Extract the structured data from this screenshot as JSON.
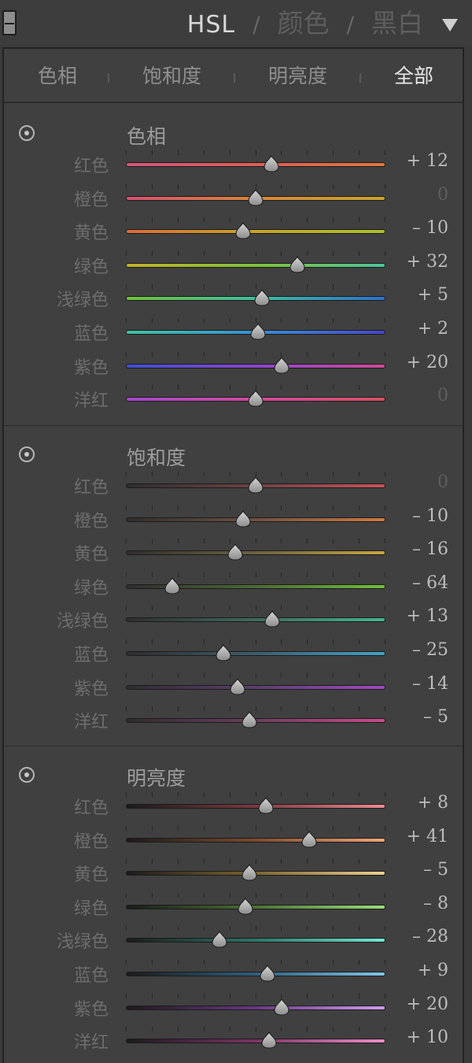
{
  "header": {
    "tabs": [
      {
        "label": "HSL",
        "active": true
      },
      {
        "label": "颜色",
        "active": false
      },
      {
        "label": "黑白",
        "active": false
      }
    ],
    "separator": "/",
    "collapse_icon": "triangle-down-icon"
  },
  "subtabs": [
    {
      "label": "色相",
      "active": false
    },
    {
      "label": "饱和度",
      "active": false
    },
    {
      "label": "明亮度",
      "active": false
    },
    {
      "label": "全部",
      "active": true
    }
  ],
  "slider_range": [
    -100,
    100
  ],
  "sections": [
    {
      "key": "hue",
      "title": "色相",
      "target_icon": "target-adjustment-icon",
      "rows": [
        {
          "label": "红色",
          "value": "+ 12",
          "num": 12,
          "colors": [
            "#d5567d",
            "#dd5e55",
            "#e2763e"
          ]
        },
        {
          "label": "橙色",
          "value": "0",
          "num": 0,
          "colors": [
            "#d95070",
            "#d8863a",
            "#c9a52c"
          ]
        },
        {
          "label": "黄色",
          "value": "– 10",
          "num": -10,
          "colors": [
            "#db6a3a",
            "#c7a42a",
            "#a8c02d"
          ]
        },
        {
          "label": "绿色",
          "value": "+ 32",
          "num": 32,
          "colors": [
            "#c2b12a",
            "#7fc13a",
            "#4cc59d"
          ]
        },
        {
          "label": "浅绿色",
          "value": "+ 5",
          "num": 5,
          "colors": [
            "#6fc23a",
            "#3fbfa0",
            "#2d6fcf"
          ]
        },
        {
          "label": "蓝色",
          "value": "+ 2",
          "num": 2,
          "colors": [
            "#3fc3a2",
            "#3a8fd3",
            "#4748c9"
          ]
        },
        {
          "label": "紫色",
          "value": "+ 20",
          "num": 20,
          "colors": [
            "#3f4fd0",
            "#8a46cc",
            "#cf4a98"
          ]
        },
        {
          "label": "洋红",
          "value": "0",
          "num": 0,
          "colors": [
            "#a448cf",
            "#d4489b",
            "#d94f62"
          ]
        }
      ]
    },
    {
      "key": "saturation",
      "title": "饱和度",
      "target_icon": "target-adjustment-icon",
      "rows": [
        {
          "label": "红色",
          "value": "0",
          "num": 0,
          "colors": [
            "#2e2e2e",
            "#6e4345",
            "#c9525c"
          ]
        },
        {
          "label": "橙色",
          "value": "– 10",
          "num": -10,
          "colors": [
            "#2e2e2e",
            "#6f5140",
            "#cc7a42"
          ]
        },
        {
          "label": "黄色",
          "value": "– 16",
          "num": -16,
          "colors": [
            "#2e2e2e",
            "#6b6240",
            "#c8a540"
          ]
        },
        {
          "label": "绿色",
          "value": "– 64",
          "num": -64,
          "colors": [
            "#2e2e2e",
            "#4c6a34",
            "#6fc03a"
          ]
        },
        {
          "label": "浅绿色",
          "value": "+ 13",
          "num": 13,
          "colors": [
            "#2e2e2e",
            "#3f6a5e",
            "#45b493"
          ]
        },
        {
          "label": "蓝色",
          "value": "– 25",
          "num": -25,
          "colors": [
            "#2e2e2e",
            "#3f5d6d",
            "#43a3c8"
          ]
        },
        {
          "label": "紫色",
          "value": "– 14",
          "num": -14,
          "colors": [
            "#2e2e2e",
            "#5a3f6e",
            "#a348c6"
          ]
        },
        {
          "label": "洋红",
          "value": "– 5",
          "num": -5,
          "colors": [
            "#2e2e2e",
            "#6a3f58",
            "#cb4a8e"
          ]
        }
      ]
    },
    {
      "key": "luminance",
      "title": "明亮度",
      "target_icon": "target-adjustment-icon",
      "rows": [
        {
          "label": "红色",
          "value": "+ 8",
          "num": 8,
          "colors": [
            "#1b1b1b",
            "#7a3940",
            "#ee8a92"
          ]
        },
        {
          "label": "橙色",
          "value": "+ 41",
          "num": 41,
          "colors": [
            "#1b1b1b",
            "#7d4a2c",
            "#f0a67a"
          ]
        },
        {
          "label": "黄色",
          "value": "– 5",
          "num": -5,
          "colors": [
            "#1b1b1b",
            "#7a6530",
            "#eed091"
          ]
        },
        {
          "label": "绿色",
          "value": "– 8",
          "num": -8,
          "colors": [
            "#1b1b1b",
            "#4b7233",
            "#97e07a"
          ]
        },
        {
          "label": "浅绿色",
          "value": "– 28",
          "num": -28,
          "colors": [
            "#1b1b1b",
            "#2f7468",
            "#73e6cf"
          ]
        },
        {
          "label": "蓝色",
          "value": "+ 9",
          "num": 9,
          "colors": [
            "#1b1b1b",
            "#2e5f7c",
            "#7fc5ea"
          ]
        },
        {
          "label": "紫色",
          "value": "+ 20",
          "num": 20,
          "colors": [
            "#1b1b1b",
            "#6a3684",
            "#d39bf0"
          ]
        },
        {
          "label": "洋红",
          "value": "+ 10",
          "num": 10,
          "colors": [
            "#1b1b1b",
            "#7c3462",
            "#ef8fc3"
          ]
        }
      ]
    }
  ]
}
